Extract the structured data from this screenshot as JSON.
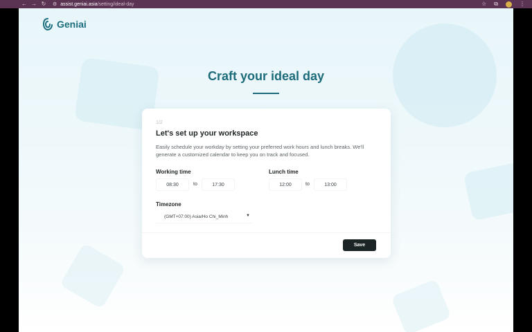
{
  "browser": {
    "back_icon": "←",
    "forward_icon": "→",
    "reload_icon": "↻",
    "site_icon": "⚙",
    "url_host": "assist.geniai.asia",
    "url_path": "/setting/ideal-day",
    "star_icon": "☆",
    "extensions_icon": "⧉",
    "menu_icon": "⋮"
  },
  "app": {
    "logo_text": "Geniai",
    "brand_color": "#1a6e7d"
  },
  "page": {
    "title": "Craft your ideal day"
  },
  "card": {
    "step": "1/2",
    "title": "Let's set up your workspace",
    "description": "Easily schedule your workday by setting your preferred work hours and lunch breaks. We'll generate a customized calendar to keep you on track and focused.",
    "working_time": {
      "label": "Working time",
      "start": "08:30",
      "separator": "to",
      "end": "17:30"
    },
    "lunch_time": {
      "label": "Lunch time",
      "start": "12:00",
      "separator": "to",
      "end": "13:00"
    },
    "timezone": {
      "label": "Timezone",
      "value": "(GMT+07:00) Asia/Ho Chi_Minh",
      "caret_icon": "▼"
    },
    "save_label": "Save"
  }
}
